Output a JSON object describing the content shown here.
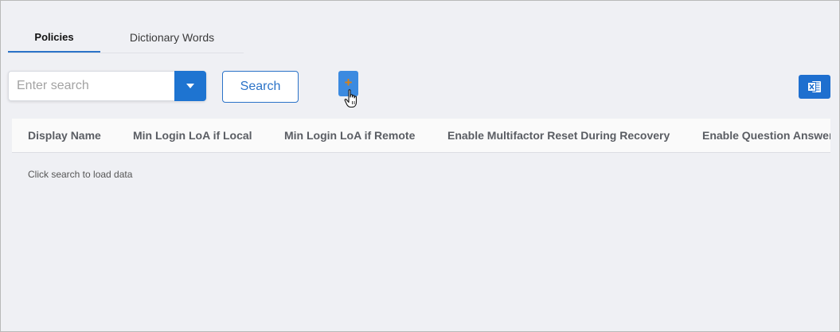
{
  "tabs": [
    {
      "label": "Policies",
      "active": true
    },
    {
      "label": "Dictionary Words",
      "active": false
    }
  ],
  "search": {
    "placeholder": "Enter search",
    "value": "",
    "button_label": "Search"
  },
  "toolbar": {
    "add_label": "+",
    "add_icon": "plus-icon",
    "export_icon": "excel-icon"
  },
  "table": {
    "columns": [
      "Display Name",
      "Min Login LoA if Local",
      "Min Login LoA if Remote",
      "Enable Multifactor Reset During Recovery",
      "Enable Question Answer"
    ],
    "empty_message": "Click search to load data"
  },
  "colors": {
    "accent": "#1e74d1",
    "background": "#eff0f4",
    "add_icon_color": "#d6821a"
  }
}
